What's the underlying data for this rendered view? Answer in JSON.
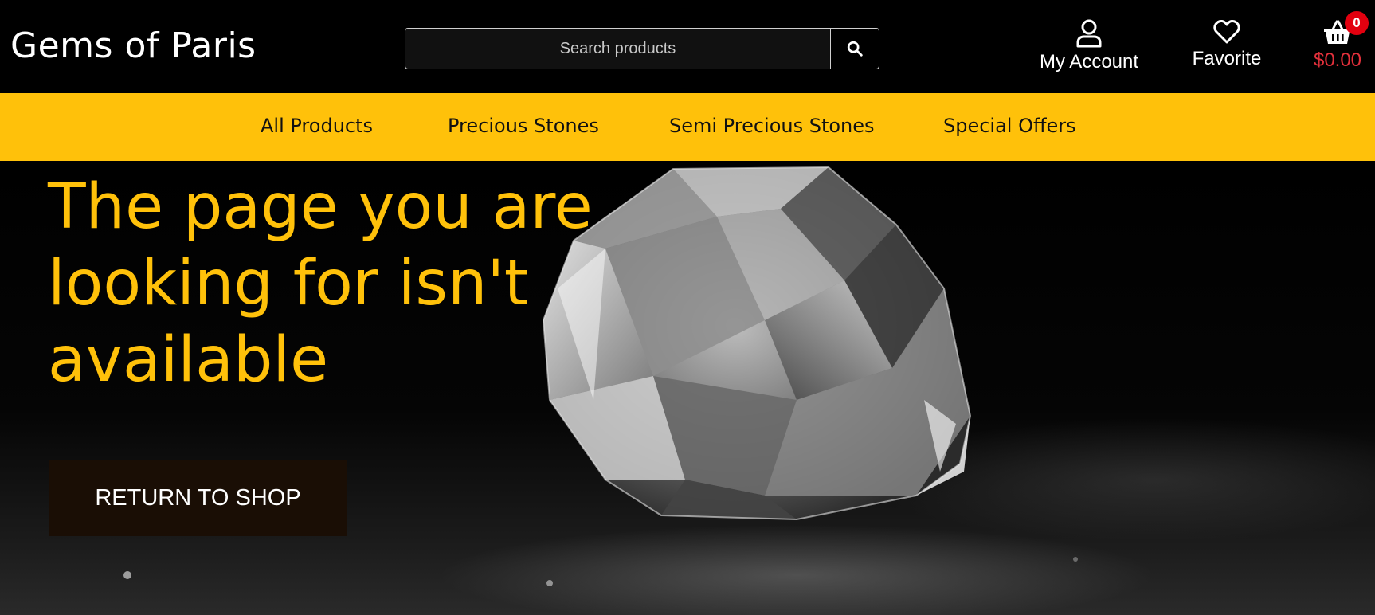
{
  "header": {
    "logo": "Gems of Paris",
    "search": {
      "placeholder": "Search products",
      "button_icon": "search-icon"
    },
    "account": {
      "label": "My Account",
      "icon": "user-icon"
    },
    "favorite": {
      "label": "Favorite",
      "icon": "heart-icon"
    },
    "cart": {
      "total": "$0.00",
      "count": "0",
      "icon": "basket-icon"
    }
  },
  "nav": {
    "items": [
      {
        "label": "All Products"
      },
      {
        "label": "Precious Stones"
      },
      {
        "label": "Semi Precious Stones"
      },
      {
        "label": "Special Offers"
      }
    ]
  },
  "hero": {
    "title": "The page you are looking for isn't available",
    "button_label": "RETURN TO SHOP"
  },
  "colors": {
    "accent": "#ffc10a",
    "background": "#000000",
    "cart_total": "#e2303b",
    "badge": "#e3000f",
    "button_bg": "#1a0e05"
  }
}
